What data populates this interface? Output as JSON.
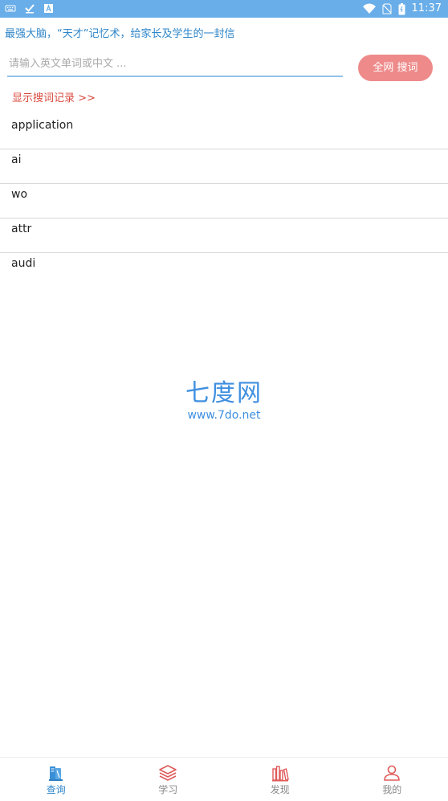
{
  "status_bar": {
    "time": "11:37",
    "icons": [
      "keyboard-icon",
      "check-icon",
      "a-box-icon",
      "wifi-icon",
      "no-sim-icon",
      "battery-icon"
    ]
  },
  "header": {
    "slogan": "最强大脑，“天才”记忆术，给家长及学生的一封信"
  },
  "search": {
    "placeholder": "请输入英文单词或中文 ...",
    "value": "",
    "button_label": "全网 搜词",
    "history_toggle": "显示搜词记录 >>"
  },
  "history": {
    "items": [
      "application",
      "ai",
      "wo",
      "attr",
      "audi"
    ]
  },
  "watermark": {
    "logo": "七度网",
    "url": "www.7do.net"
  },
  "bottom_nav": {
    "items": [
      {
        "label": "查询",
        "icon": "books-icon",
        "active": true
      },
      {
        "label": "学习",
        "icon": "layers-icon",
        "active": false
      },
      {
        "label": "发现",
        "icon": "bookshelf-icon",
        "active": false
      },
      {
        "label": "我的",
        "icon": "user-icon",
        "active": false
      }
    ]
  },
  "colors": {
    "status_bar": "#6aaee9",
    "accent": "#2f86c9",
    "button": "#ee8a8a",
    "history_toggle": "#d94a3e",
    "red_icon": "#e05a5a"
  }
}
